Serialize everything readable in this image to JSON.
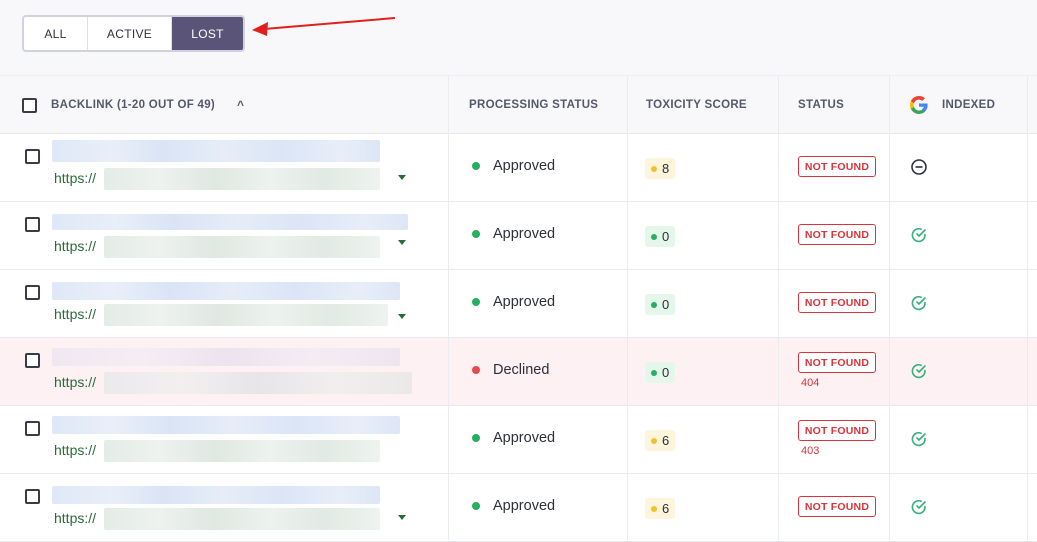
{
  "filter": {
    "tabs": [
      {
        "label": "ALL",
        "selected": false
      },
      {
        "label": "ACTIVE",
        "selected": false
      },
      {
        "label": "LOST",
        "selected": true
      }
    ]
  },
  "table": {
    "headers": {
      "backlink": "BACKLINK (1-20 OUT OF 49)",
      "processing": "PROCESSING STATUS",
      "toxicity": "TOXICITY SCORE",
      "status": "STATUS",
      "indexed": "INDEXED"
    },
    "rows": [
      {
        "link_prefix": "https://",
        "processing": "Approved",
        "processing_color": "#27ae60",
        "toxicity": "8",
        "toxicity_level": "yellow",
        "status": "NOT FOUND",
        "code": "",
        "indexed": "not-indexed"
      },
      {
        "link_prefix": "https://",
        "processing": "Approved",
        "processing_color": "#27ae60",
        "toxicity": "0",
        "toxicity_level": "green",
        "status": "NOT FOUND",
        "code": "",
        "indexed": "indexed"
      },
      {
        "link_prefix": "https://",
        "processing": "Approved",
        "processing_color": "#27ae60",
        "toxicity": "0",
        "toxicity_level": "green",
        "status": "NOT FOUND",
        "code": "",
        "indexed": "indexed"
      },
      {
        "link_prefix": "https://",
        "processing": "Declined",
        "processing_color": "#e5484d",
        "toxicity": "0",
        "toxicity_level": "green",
        "status": "NOT FOUND",
        "code": "404",
        "indexed": "indexed"
      },
      {
        "link_prefix": "https://",
        "processing": "Approved",
        "processing_color": "#27ae60",
        "toxicity": "6",
        "toxicity_level": "yellow",
        "status": "NOT FOUND",
        "code": "403",
        "indexed": "indexed"
      },
      {
        "link_prefix": "https://",
        "processing": "Approved",
        "processing_color": "#27ae60",
        "toxicity": "6",
        "toxicity_level": "yellow",
        "status": "NOT FOUND",
        "code": "",
        "indexed": "indexed"
      }
    ]
  },
  "colors": {
    "selected_tab": "#5a5479",
    "approved": "#27ae60",
    "declined": "#e5484d",
    "not_found": "#d6353d",
    "link": "#2a6b3a",
    "toxicity_yellow_dot": "#f2c12e",
    "toxicity_green_dot": "#27ae60"
  }
}
